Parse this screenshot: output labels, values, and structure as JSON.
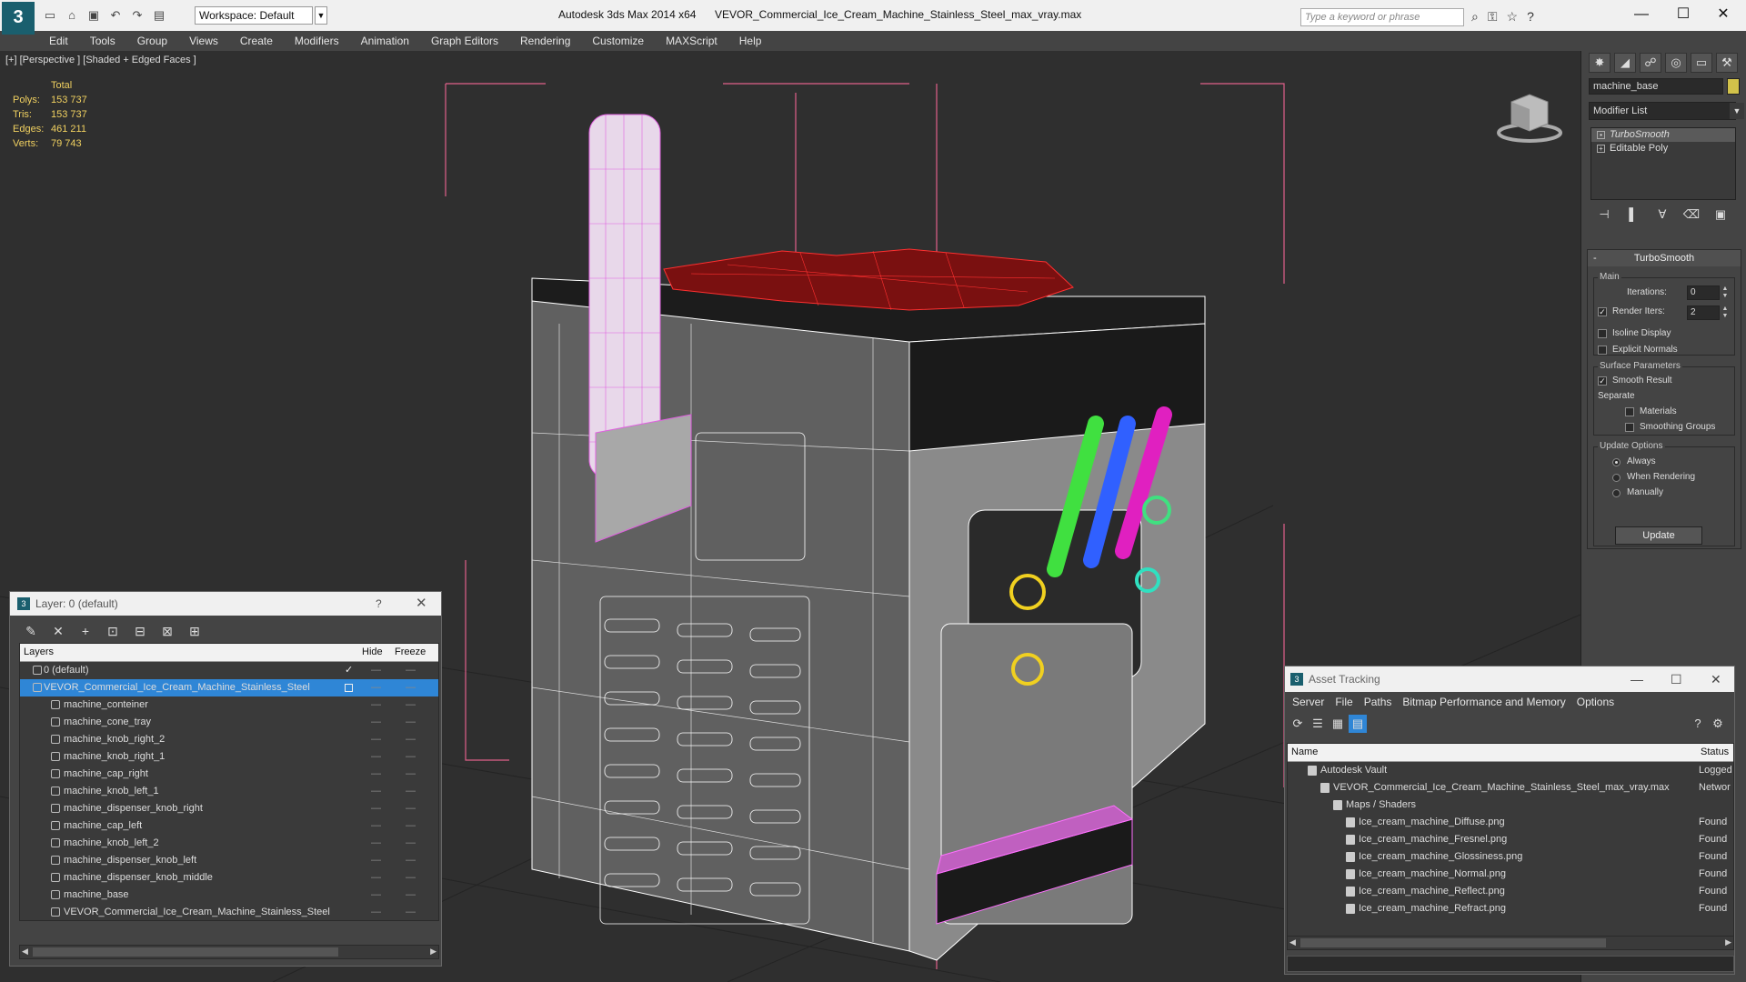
{
  "titlebar": {
    "workspace_label": "Workspace: Default",
    "app_title": "Autodesk 3ds Max  2014 x64",
    "file_name": "VEVOR_Commercial_Ice_Cream_Machine_Stainless_Steel_max_vray.max",
    "search_placeholder": "Type a keyword or phrase",
    "minimize": "—",
    "maximize": "☐",
    "close": "✕"
  },
  "menu": [
    "Edit",
    "Tools",
    "Group",
    "Views",
    "Create",
    "Modifiers",
    "Animation",
    "Graph Editors",
    "Rendering",
    "Customize",
    "MAXScript",
    "Help"
  ],
  "viewport": {
    "label": "[+] [Perspective ] [Shaded + Edged Faces ]",
    "stats": {
      "total_label": "Total",
      "polys_label": "Polys:",
      "polys": "153 737",
      "tris_label": "Tris:",
      "tris": "153 737",
      "edges_label": "Edges:",
      "edges": "461 211",
      "verts_label": "Verts:",
      "verts": "79 743"
    }
  },
  "command_panel": {
    "object_name": "machine_base",
    "object_color": "#d2c24a",
    "modifier_list": "Modifier List",
    "stack": [
      "TurboSmooth",
      "Editable Poly"
    ],
    "turbosmooth": {
      "title": "TurboSmooth",
      "main": "Main",
      "iterations_label": "Iterations:",
      "iterations": "0",
      "render_iters_label": "Render Iters:",
      "render_iters": "2",
      "render_iters_checked": true,
      "isoline": "Isoline Display",
      "explicit_normals": "Explicit Normals",
      "surface_params": "Surface Parameters",
      "smooth_result": "Smooth Result",
      "smooth_result_checked": true,
      "separate": "Separate",
      "materials": "Materials",
      "smoothing_groups": "Smoothing Groups",
      "update_options": "Update Options",
      "always": "Always",
      "when_rendering": "When Rendering",
      "manually": "Manually",
      "update_button": "Update",
      "selected_update": "Always"
    }
  },
  "layer_window": {
    "title": "Layer: 0 (default)",
    "help": "?",
    "close": "✕",
    "col_layers": "Layers",
    "col_hide": "Hide",
    "col_freeze": "Freeze",
    "rows": [
      {
        "name": "0 (default)",
        "level": 0,
        "active": true
      },
      {
        "name": "VEVOR_Commercial_Ice_Cream_Machine_Stainless_Steel",
        "level": 0,
        "selected": true
      },
      {
        "name": "machine_conteiner",
        "level": 1
      },
      {
        "name": "machine_cone_tray",
        "level": 1
      },
      {
        "name": "machine_knob_right_2",
        "level": 1
      },
      {
        "name": "machine_knob_right_1",
        "level": 1
      },
      {
        "name": "machine_cap_right",
        "level": 1
      },
      {
        "name": "machine_knob_left_1",
        "level": 1
      },
      {
        "name": "machine_dispenser_knob_right",
        "level": 1
      },
      {
        "name": "machine_cap_left",
        "level": 1
      },
      {
        "name": "machine_knob_left_2",
        "level": 1
      },
      {
        "name": "machine_dispenser_knob_left",
        "level": 1
      },
      {
        "name": "machine_dispenser_knob_middle",
        "level": 1
      },
      {
        "name": "machine_base",
        "level": 1
      },
      {
        "name": "VEVOR_Commercial_Ice_Cream_Machine_Stainless_Steel",
        "level": 1
      }
    ]
  },
  "asset_tracking": {
    "title": "Asset Tracking",
    "menu": [
      "Server",
      "File",
      "Paths",
      "Bitmap Performance and Memory",
      "Options"
    ],
    "col_name": "Name",
    "col_status": "Status",
    "rows": [
      {
        "name": "Autodesk Vault",
        "indent": 1,
        "status": "Logged"
      },
      {
        "name": "VEVOR_Commercial_Ice_Cream_Machine_Stainless_Steel_max_vray.max",
        "indent": 2,
        "status": "Networ"
      },
      {
        "name": "Maps / Shaders",
        "indent": 3,
        "status": ""
      },
      {
        "name": "Ice_cream_machine_Diffuse.png",
        "indent": 4,
        "status": "Found"
      },
      {
        "name": "Ice_cream_machine_Fresnel.png",
        "indent": 4,
        "status": "Found"
      },
      {
        "name": "Ice_cream_machine_Glossiness.png",
        "indent": 4,
        "status": "Found"
      },
      {
        "name": "Ice_cream_machine_Normal.png",
        "indent": 4,
        "status": "Found"
      },
      {
        "name": "Ice_cream_machine_Reflect.png",
        "indent": 4,
        "status": "Found"
      },
      {
        "name": "Ice_cream_machine_Refract.png",
        "indent": 4,
        "status": "Found"
      }
    ]
  }
}
